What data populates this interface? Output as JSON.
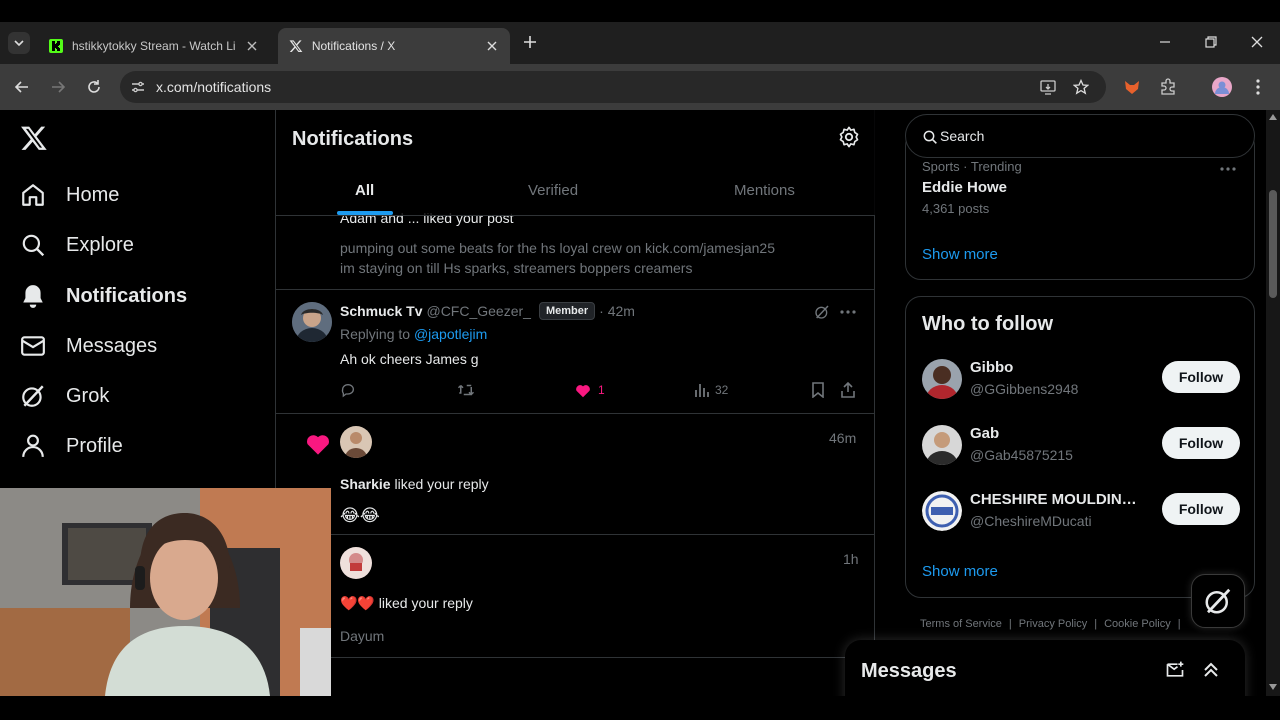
{
  "browser": {
    "tabs": [
      {
        "title": "hstikkytokky Stream - Watch Li",
        "favicon": "kick-icon",
        "active": false
      },
      {
        "title": "Notifications / X",
        "favicon": "x-logo-icon",
        "active": true
      }
    ],
    "url": "x.com/notifications"
  },
  "nav": {
    "items": [
      {
        "label": "Home",
        "icon": "home-icon"
      },
      {
        "label": "Explore",
        "icon": "search-icon"
      },
      {
        "label": "Notifications",
        "icon": "bell-icon"
      },
      {
        "label": "Messages",
        "icon": "envelope-icon"
      },
      {
        "label": "Grok",
        "icon": "grok-icon"
      },
      {
        "label": "Profile",
        "icon": "person-icon"
      }
    ]
  },
  "main": {
    "title": "Notifications",
    "tabs": [
      "All",
      "Verified",
      "Mentions"
    ],
    "partial_note": {
      "header": "Adam and ... liked your post",
      "line1": "pumping out some beats for the hs loyal crew on kick.com/jamesjan25",
      "line2": "im staying on till Hs sparks, streamers boppers creamers"
    },
    "reply": {
      "name": "Schmuck Tv",
      "handle": "@CFC_Geezer_",
      "badge": "Member",
      "time": "· 42m",
      "replying_label": "Replying to",
      "replying_to": "@japotlejim",
      "text": "Ah ok cheers James g",
      "likes": "1",
      "views": "32"
    },
    "like1": {
      "name": "Sharkie",
      "action": "liked your reply",
      "time": "46m",
      "content": "😂😂"
    },
    "like2": {
      "emoji": "❤️❤️",
      "action": "liked your reply",
      "time": "1h",
      "content": "Dayum"
    }
  },
  "right": {
    "search_placeholder": "Search",
    "trend": {
      "category": "Sports · Trending",
      "name": "Eddie Howe",
      "posts": "4,361 posts",
      "show_more": "Show more"
    },
    "who_to_follow": {
      "title": "Who to follow",
      "users": [
        {
          "name": "Gibbo",
          "handle": "@GGibbens2948",
          "button": "Follow"
        },
        {
          "name": "Gab",
          "handle": "@Gab45875215",
          "button": "Follow"
        },
        {
          "name": "CHESHIRE MOULDING...",
          "handle": "@CheshireMDucati",
          "button": "Follow"
        }
      ],
      "show_more": "Show more"
    },
    "footer": [
      "Terms of Service",
      "Privacy Policy",
      "Cookie Policy"
    ],
    "messages_title": "Messages"
  },
  "colors": {
    "accent": "#1d9bf0",
    "like": "#f91880",
    "bg": "#000000",
    "border": "#2f3336"
  }
}
